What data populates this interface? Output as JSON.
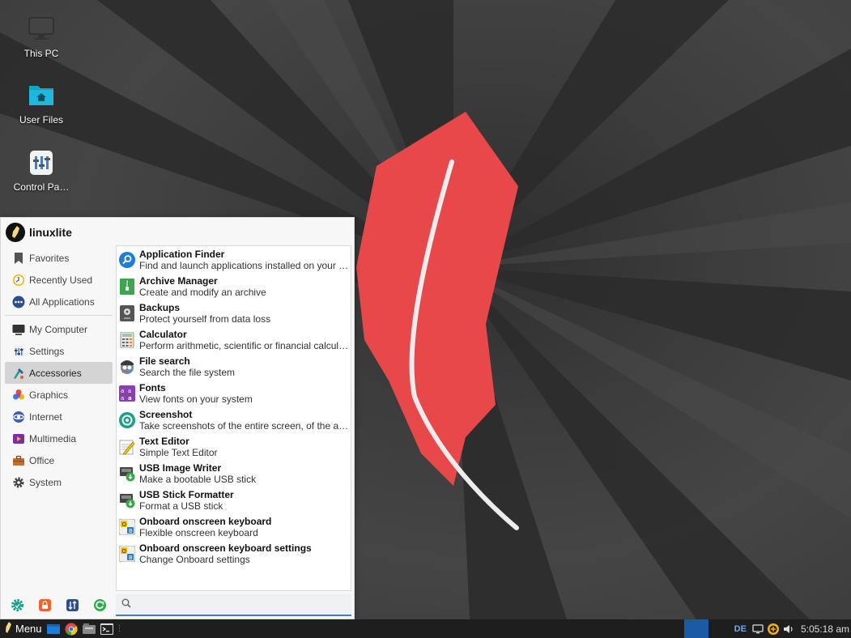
{
  "desktop": {
    "icons": [
      {
        "label": "This PC",
        "icon": "monitor-icon"
      },
      {
        "label": "User Files",
        "icon": "home-folder-icon"
      },
      {
        "label": "Control Pa…",
        "icon": "control-panel-icon"
      }
    ]
  },
  "menu": {
    "username": "linuxlite",
    "categories": [
      {
        "label": "Favorites",
        "icon": "bookmark-icon"
      },
      {
        "label": "Recently Used",
        "icon": "clock-icon"
      },
      {
        "label": "All Applications",
        "icon": "all-apps-icon"
      },
      {
        "label": "My Computer",
        "icon": "monitor-icon"
      },
      {
        "label": "Settings",
        "icon": "settings-sliders-icon"
      },
      {
        "label": "Accessories",
        "icon": "accessories-icon",
        "active": true
      },
      {
        "label": "Graphics",
        "icon": "graphics-icon"
      },
      {
        "label": "Internet",
        "icon": "internet-icon"
      },
      {
        "label": "Multimedia",
        "icon": "multimedia-icon"
      },
      {
        "label": "Office",
        "icon": "briefcase-icon"
      },
      {
        "label": "System",
        "icon": "gear-icon"
      }
    ],
    "apps": [
      {
        "name": "Application Finder",
        "desc": "Find and launch applications installed on your system",
        "icon": "magnifier-icon"
      },
      {
        "name": "Archive Manager",
        "desc": "Create and modify an archive",
        "icon": "archive-icon"
      },
      {
        "name": "Backups",
        "desc": "Protect yourself from data loss",
        "icon": "backup-icon"
      },
      {
        "name": "Calculator",
        "desc": "Perform arithmetic, scientific or financial calculations",
        "icon": "calculator-icon"
      },
      {
        "name": "File search",
        "desc": "Search the file system",
        "icon": "file-search-icon"
      },
      {
        "name": "Fonts",
        "desc": "View fonts on your system",
        "icon": "fonts-icon"
      },
      {
        "name": "Screenshot",
        "desc": "Take screenshots of the entire screen, of the active window or of a selected region",
        "icon": "screenshot-icon"
      },
      {
        "name": "Text Editor",
        "desc": "Simple Text Editor",
        "icon": "text-editor-icon"
      },
      {
        "name": "USB Image Writer",
        "desc": "Make a bootable USB stick",
        "icon": "usb-writer-icon"
      },
      {
        "name": "USB Stick Formatter",
        "desc": "Format a USB stick",
        "icon": "usb-formatter-icon"
      },
      {
        "name": "Onboard onscreen keyboard",
        "desc": "Flexible onscreen keyboard",
        "icon": "keyboard-icon"
      },
      {
        "name": "Onboard onscreen keyboard settings",
        "desc": "Change Onboard settings",
        "icon": "keyboard-settings-icon"
      }
    ],
    "footer_actions": [
      "settings-manager-icon",
      "lock-screen-icon",
      "switch-user-icon",
      "logout-icon"
    ],
    "search": {
      "value": "",
      "placeholder": ""
    }
  },
  "taskbar": {
    "menu_label": "Menu",
    "launchers": [
      "file-manager-icon",
      "chrome-icon",
      "files-icon",
      "terminal-icon"
    ],
    "keyboard_layout": "DE",
    "clock": "5:05:18 am"
  },
  "colors": {
    "accent": "#3b7dd8",
    "feather": "#e8484a",
    "workspace": "#1c5aa6"
  }
}
